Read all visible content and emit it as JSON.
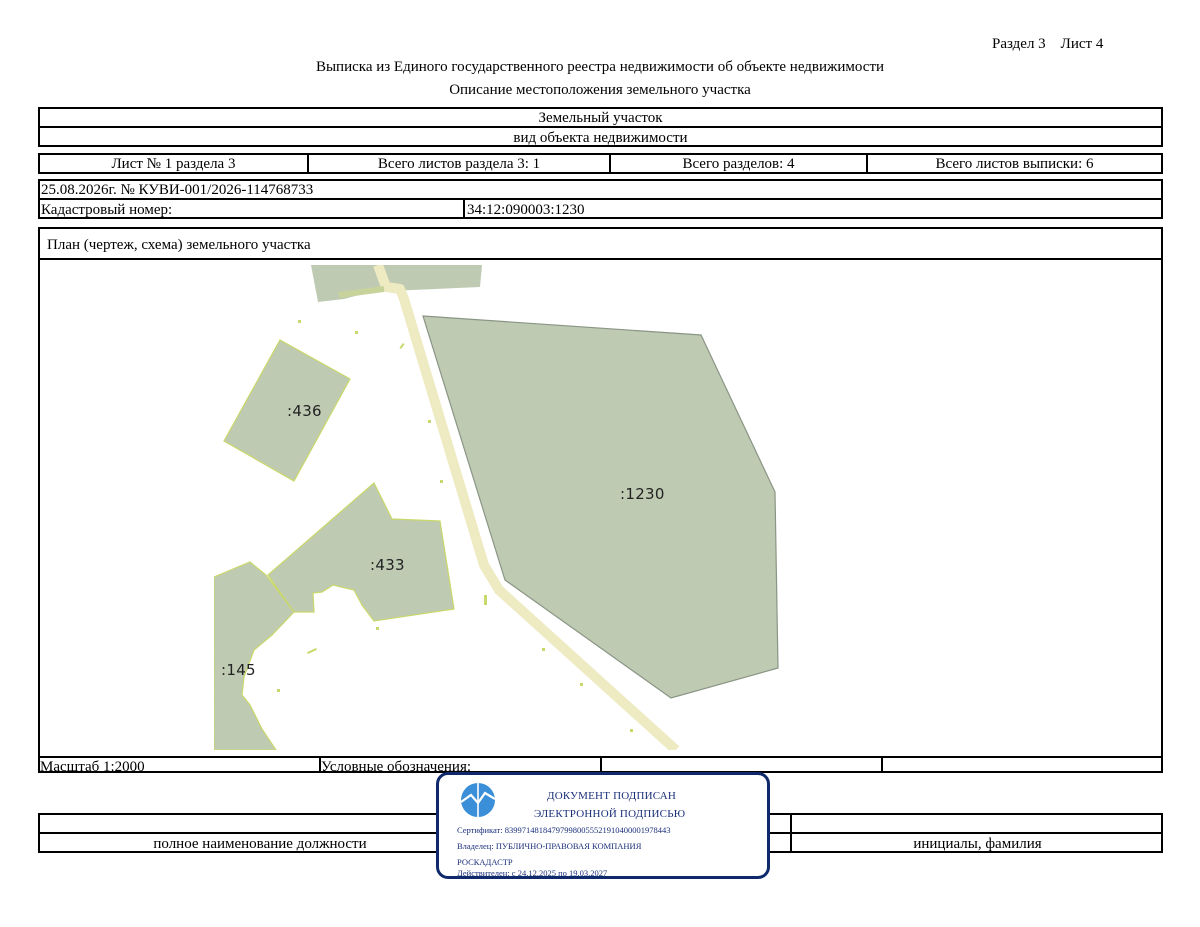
{
  "header": {
    "section_sheet": "Раздел 3    Лист 4",
    "title": "Выписка из Единого государственного реестра недвижимости об объекте недвижимости",
    "subtitle": "Описание местоположения земельного участка"
  },
  "object": {
    "type": "Земельный участок",
    "type_caption": "вид объекта недвижимости"
  },
  "sheet_info": {
    "sheet": "Лист № 1 раздела 3",
    "total_section_sheets": "Всего листов раздела 3: 1",
    "total_sections": "Всего разделов: 4",
    "total_extract_sheets": "Всего листов выписки: 6"
  },
  "record": {
    "date_number": "25.08.2026г. № КУВИ-001/2026-114768733",
    "cadastral_label": "Кадастровый номер:",
    "cadastral_value": "34:12:090003:1230"
  },
  "plan": {
    "title": "План (чертеж, схема) земельного участка",
    "parcels": [
      ":436",
      ":433",
      ":1230",
      ":145"
    ],
    "colors": {
      "parcel_fill": "#bfcab3",
      "parcel_edge": "#c9d86a",
      "road": "#eeeac2",
      "road_dark": "#c8d39c"
    }
  },
  "footer": {
    "scale": "Масштаб 1:2000",
    "legend": "Условные обозначения:",
    "position_caption": "полное наименование должности",
    "name_caption": "инициалы, фамилия"
  },
  "stamp": {
    "line1": "ДОКУМЕНТ ПОДПИСАН",
    "line2": "ЭЛЕКТРОННОЙ ПОДПИСЬЮ",
    "certificate": "Сертификат: 839971481847979980055521910400001978443",
    "owner": "Владелец: ПУБЛИЧНО-ПРАВОВАЯ КОМПАНИЯ",
    "owner2": "РОСКАДАСТР",
    "valid": "Действителен: с 24.12.2025 по 19.03.2027",
    "colors": {
      "border": "#0e2a6b",
      "text": "#1a2f7a",
      "logo": "#3a8fd8"
    }
  }
}
